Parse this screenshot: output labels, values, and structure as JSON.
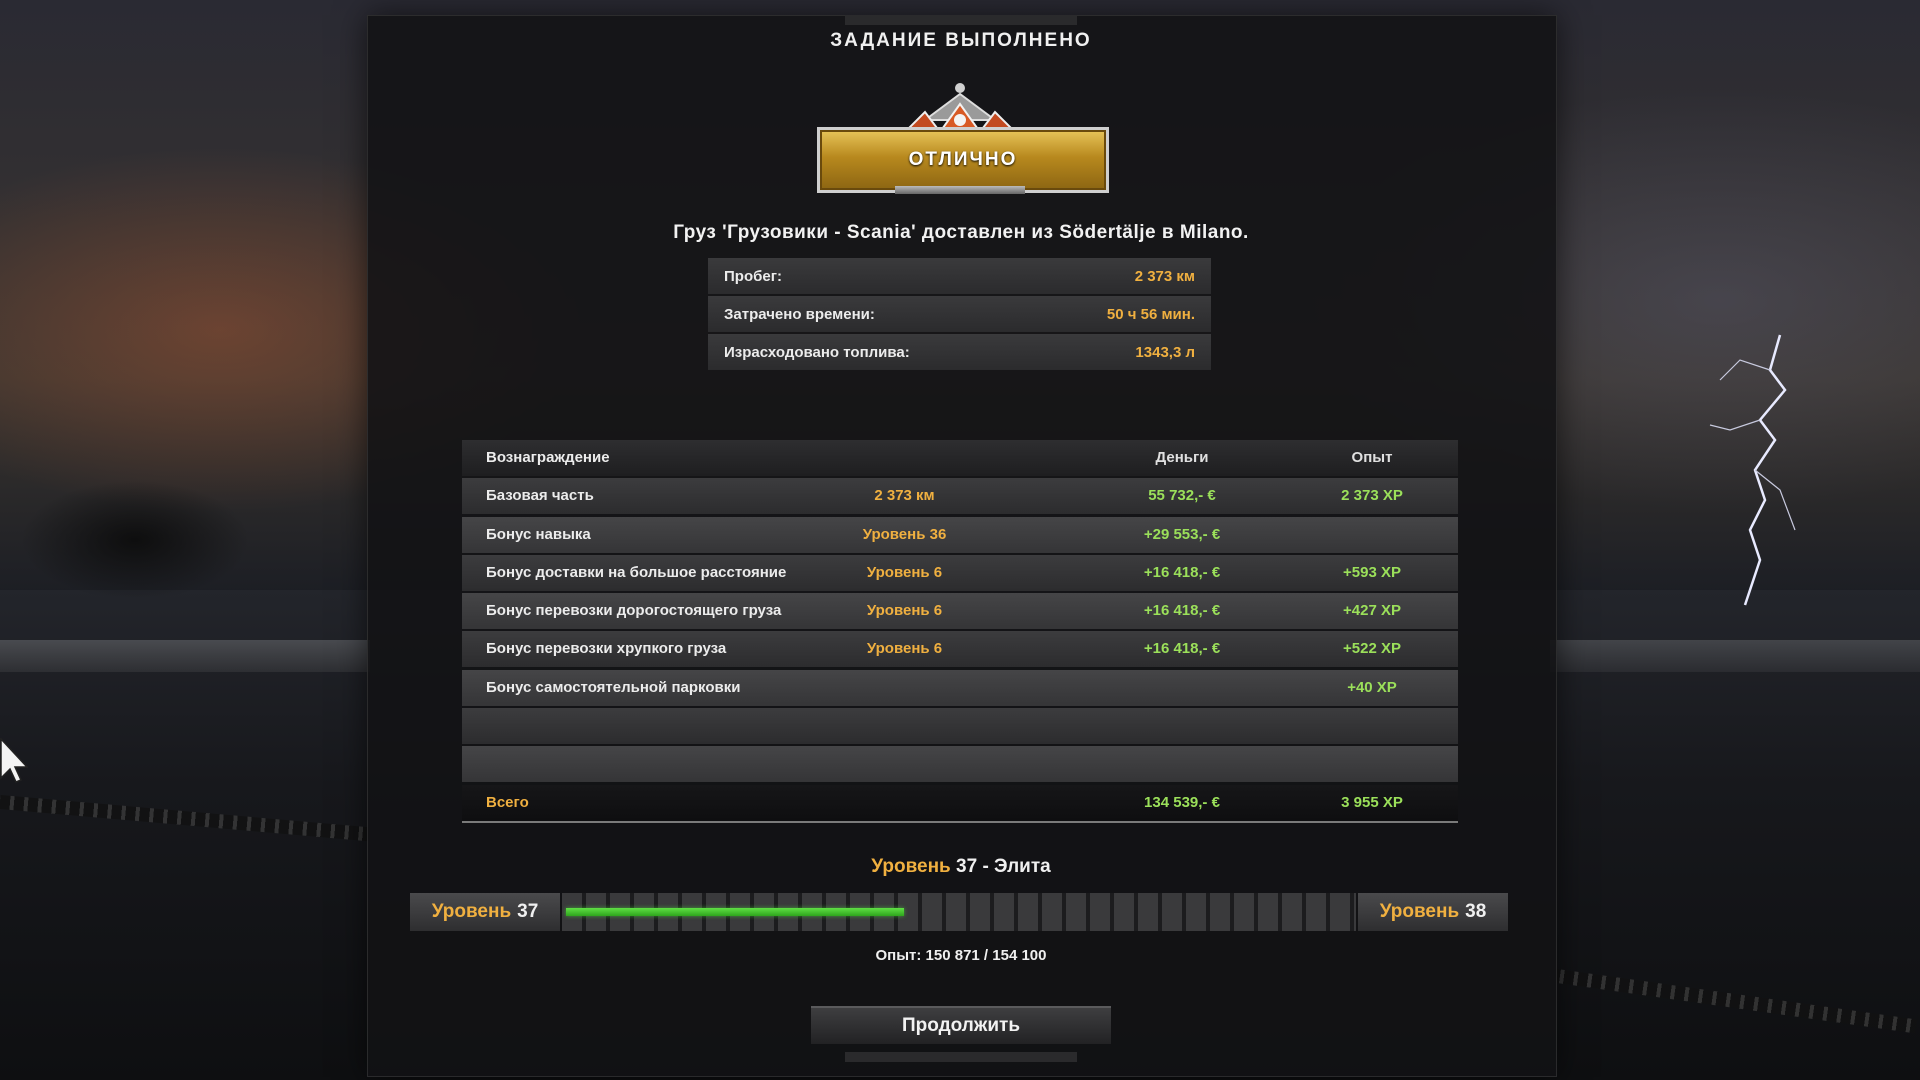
{
  "title": "ЗАДАНИЕ ВЫПОЛНЕНО",
  "badge": "ОТЛИЧНО",
  "cargo": "Груз 'Грузовики - Scania' доставлен из Södertälje в Milano.",
  "stats": [
    {
      "label": "Пробег:",
      "value": "2 373 км"
    },
    {
      "label": "Затрачено времени:",
      "value": "50 ч 56 мин."
    },
    {
      "label": "Израсходовано топлива:",
      "value": "1343,3 л"
    }
  ],
  "rewards": {
    "headers": {
      "name": "Вознаграждение",
      "money": "Деньги",
      "xp": "Опыт"
    },
    "rows": [
      {
        "name": "Базовая часть",
        "param": "2 373 км",
        "money": "55 732,- €",
        "xp": "2 373 XP"
      },
      {
        "name": "Бонус навыка",
        "param": "Уровень 36",
        "money": "+29 553,- €",
        "xp": ""
      },
      {
        "name": "Бонус доставки на большое расстояние",
        "param": "Уровень 6",
        "money": "+16 418,- €",
        "xp": "+593 XP"
      },
      {
        "name": "Бонус перевозки дорогостоящего груза",
        "param": "Уровень 6",
        "money": "+16 418,- €",
        "xp": "+427 XP"
      },
      {
        "name": "Бонус перевозки хрупкого груза",
        "param": "Уровень 6",
        "money": "+16 418,- €",
        "xp": "+522 XP"
      },
      {
        "name": "Бонус самостоятельной парковки",
        "param": "",
        "money": "",
        "xp": "+40 XP"
      },
      {
        "name": "",
        "param": "",
        "money": "",
        "xp": ""
      },
      {
        "name": "",
        "param": "",
        "money": "",
        "xp": ""
      }
    ],
    "total": {
      "name": "Всего",
      "money": "134 539,- €",
      "xp": "3 955 XP"
    }
  },
  "level": {
    "word": "Уровень",
    "current_num": "37",
    "rank": "- Элита",
    "next_num": "38",
    "xp_current": 150871,
    "xp_target": 154100,
    "xp_text": "Опыт: 150 871 / 154 100",
    "progress_shown": 0.43
  },
  "continue_label": "Продолжить",
  "colors": {
    "gold": "#f0b040",
    "green": "#9be05a",
    "bar": "#3fcf2a"
  }
}
